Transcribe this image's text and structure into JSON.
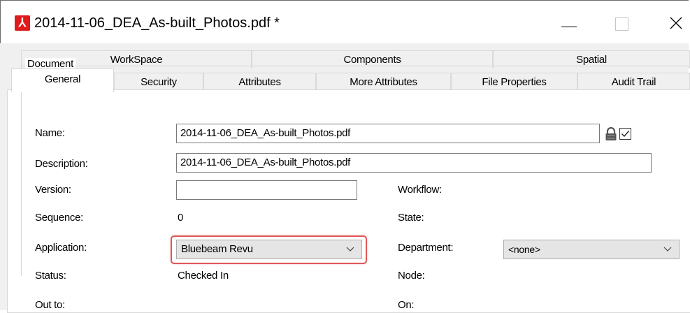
{
  "window": {
    "title": "2014-11-06_DEA_As-built_Photos.pdf *",
    "app_icon": "acrobat-pdf-icon",
    "controls": [
      "minimize-icon",
      "maximize-icon",
      "close-icon"
    ]
  },
  "tabs": {
    "row1": [
      "WorkSpace",
      "Components",
      "Spatial"
    ],
    "row2": [
      "General",
      "Security",
      "Attributes",
      "More Attributes",
      "File Properties",
      "Audit Trail"
    ],
    "selected": "General"
  },
  "document": {
    "group_label": "Document",
    "name_label": "Name:",
    "name_value": "2014-11-06_DEA_As-built_Photos.pdf",
    "description_label": "Description:",
    "description_value": "2014-11-06_DEA_As-built_Photos.pdf",
    "version_label": "Version:",
    "version_value": "",
    "workflow_label": "Workflow:",
    "sequence_label": "Sequence:",
    "sequence_value": "0",
    "state_label": "State:",
    "application_label": "Application:",
    "application_value": "Bluebeam Revu",
    "department_label": "Department:",
    "department_value": "<none>",
    "status_label": "Status:",
    "status_value": "Checked In",
    "node_label": "Node:",
    "outto_label": "Out to:",
    "on_label": "On:",
    "name_locked_icon": "lock-icon",
    "name_checkbox_checked": true
  },
  "highlight_color": "#e05757"
}
